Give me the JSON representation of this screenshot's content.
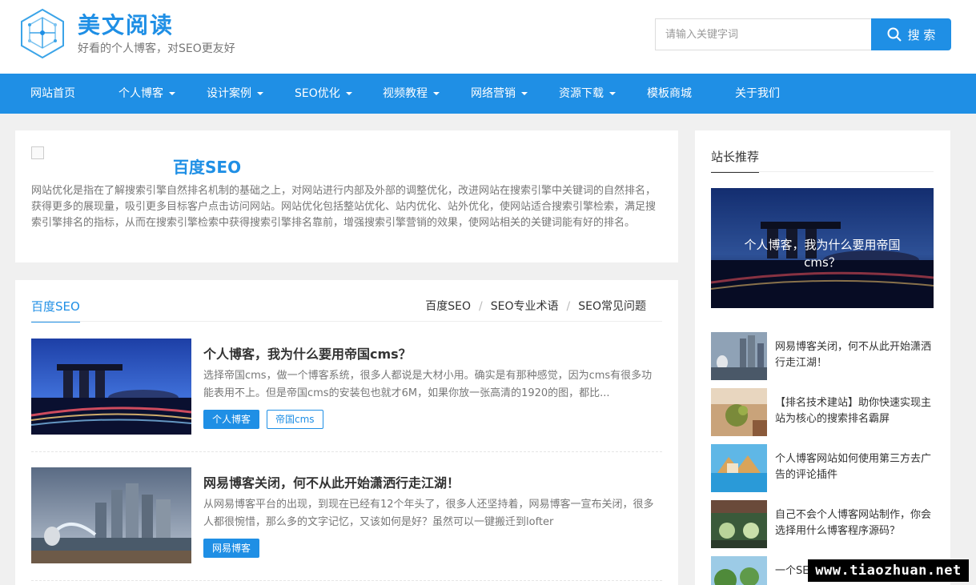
{
  "header": {
    "site_title": "美文阅读",
    "site_subtitle": "好看的个人博客，对SEO更友好",
    "search_placeholder": "请输入关键字词",
    "search_label": "搜 索"
  },
  "nav": {
    "items": [
      {
        "label": "网站首页",
        "dropdown": false
      },
      {
        "label": "个人博客",
        "dropdown": true
      },
      {
        "label": "设计案例",
        "dropdown": true
      },
      {
        "label": "SEO优化",
        "dropdown": true
      },
      {
        "label": "视频教程",
        "dropdown": true
      },
      {
        "label": "网络营销",
        "dropdown": true
      },
      {
        "label": "资源下载",
        "dropdown": true
      },
      {
        "label": "模板商城",
        "dropdown": false
      },
      {
        "label": "关于我们",
        "dropdown": false
      }
    ]
  },
  "intro": {
    "title": "百度SEO",
    "description": "网站优化是指在了解搜索引擎自然排名机制的基础之上，对网站进行内部及外部的调整优化，改进网站在搜索引擎中关键词的自然排名，获得更多的展现量，吸引更多目标客户点击访问网站。网站优化包括整站优化、站内优化、站外优化，使网站适合搜索引擎检索，满足搜索引擎排名的指标，从而在搜索引擎检索中获得搜索引擎排名靠前，增强搜索引擎营销的效果，使网站相关的关键词能有好的排名。"
  },
  "list": {
    "active_tab": "百度SEO",
    "subtabs": [
      "百度SEO",
      "SEO专业术语",
      "SEO常见问题"
    ],
    "articles": [
      {
        "title": "个人博客，我为什么要用帝国cms？",
        "desc": "选择帝国cms，做一个博客系统，很多人都说是大材小用。确实是有那种感觉，因为cms有很多功能表用不上。但是帝国cms的安装包也就才6M，如果你放一张高清的1920的图，都比...",
        "tags": [
          "个人博客",
          "帝国cms"
        ]
      },
      {
        "title": "网易博客关闭，何不从此开始潇洒行走江湖！",
        "desc": "从网易博客平台的出现，到现在已经有12个年头了，很多人还坚持着，网易博客一宣布关闭，很多人都很惋惜，那么多的文字记忆，又该如何是好？虽然可以一键搬迁到lofter",
        "tags": [
          "网易博客"
        ]
      }
    ]
  },
  "sidebar": {
    "title": "站长推荐",
    "feature_caption": "个人博客，我为什么要用帝国cms？",
    "items": [
      {
        "title": "网易博客关闭，何不从此开始潇洒行走江湖！"
      },
      {
        "title": "【排名技术建站】助你快速实现主站为核心的搜索排名霸屏"
      },
      {
        "title": "个人博客网站如何使用第三方去广告的评论插件"
      },
      {
        "title": "自己不会个人博客网站制作，你会选择用什么博客程序源码？"
      },
      {
        "title": "一个SEO小白应该如何学习?"
      }
    ]
  },
  "watermark": "www.tiaozhuan.net",
  "colors": {
    "accent": "#1f8fe5"
  }
}
